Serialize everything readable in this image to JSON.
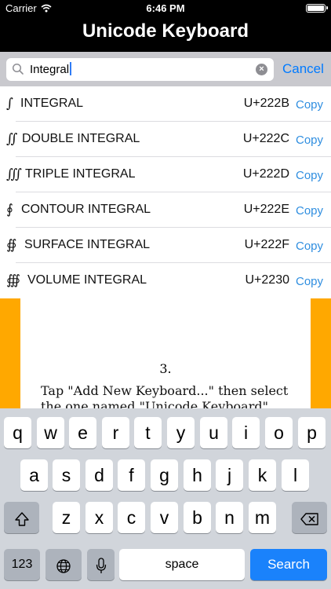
{
  "status_bar": {
    "carrier": "Carrier",
    "time": "6:46 PM",
    "battery_level": 1.0
  },
  "nav": {
    "title": "Unicode Keyboard"
  },
  "search": {
    "value": "Integral",
    "cancel_label": "Cancel",
    "clear_icon": "×"
  },
  "results": [
    {
      "glyph": "∫",
      "name": "INTEGRAL",
      "code": "U+222B",
      "copy_label": "Copy"
    },
    {
      "glyph": "∬",
      "name": "DOUBLE INTEGRAL",
      "code": "U+222C",
      "copy_label": "Copy"
    },
    {
      "glyph": "∭",
      "name": "TRIPLE INTEGRAL",
      "code": "U+222D",
      "copy_label": "Copy"
    },
    {
      "glyph": "∮",
      "name": "CONTOUR INTEGRAL",
      "code": "U+222E",
      "copy_label": "Copy"
    },
    {
      "glyph": "∯",
      "name": "SURFACE INTEGRAL",
      "code": "U+222F",
      "copy_label": "Copy"
    },
    {
      "glyph": "∰",
      "name": "VOLUME INTEGRAL",
      "code": "U+2230",
      "copy_label": "Copy"
    }
  ],
  "background_page": {
    "page_number": "3.",
    "line1": "Tap \"Add New Keyboard...\" then select",
    "line2": "the one named \"Unicode Keyboard\"."
  },
  "keyboard": {
    "row1": [
      "q",
      "w",
      "e",
      "r",
      "t",
      "y",
      "u",
      "i",
      "o",
      "p"
    ],
    "row2": [
      "a",
      "s",
      "d",
      "f",
      "g",
      "h",
      "j",
      "k",
      "l"
    ],
    "row3": [
      "z",
      "x",
      "c",
      "v",
      "b",
      "n",
      "m"
    ],
    "numbers_label": "123",
    "space_label": "space",
    "search_label": "Search",
    "shift_icon": "shift-icon",
    "delete_icon": "delete-icon",
    "globe_icon": "globe-icon",
    "mic_icon": "microphone-icon"
  },
  "colors": {
    "accent": "#007aff",
    "search_key": "#1a82fb",
    "page_background": "#ffa800"
  }
}
